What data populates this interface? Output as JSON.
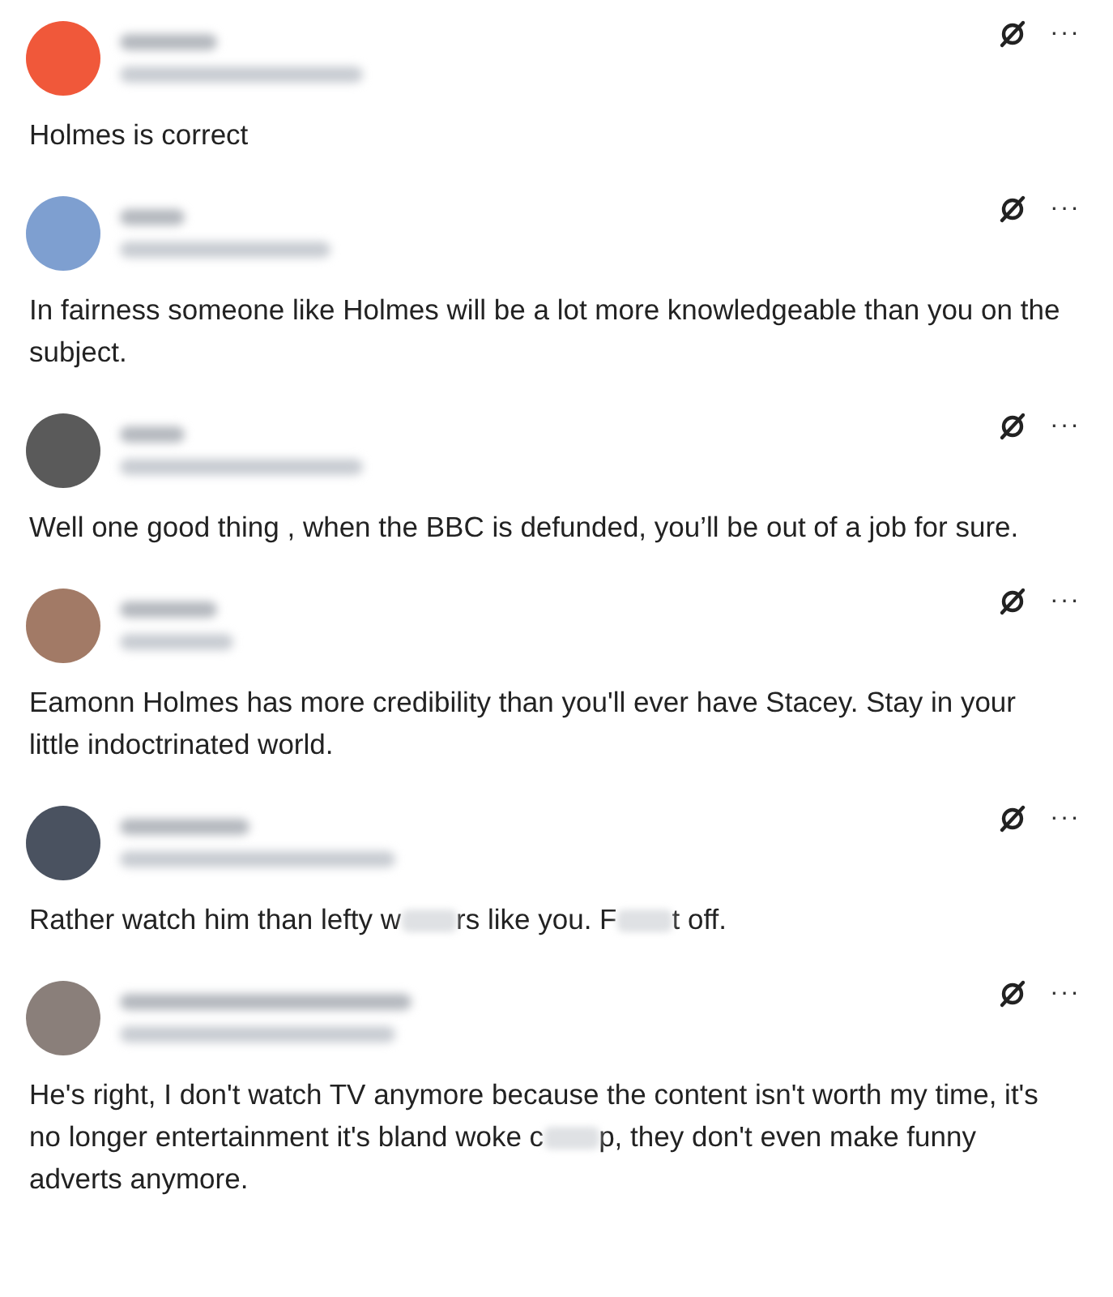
{
  "replies": [
    {
      "color": "#f0583a",
      "more": "···",
      "parts": [
        "Holmes is correct"
      ]
    },
    {
      "color": "#7e9fd0",
      "more": "···",
      "parts": [
        "In fairness someone like Holmes will be a lot more knowledgeable than you on the subject."
      ]
    },
    {
      "color": "#5a5a5a",
      "more": "···",
      "parts": [
        "Well one good thing , when the BBC is defunded, you’ll be out of a job for sure."
      ]
    },
    {
      "color": "#a27a66",
      "more": "···",
      "parts": [
        "Eamonn Holmes has more credibility than you'll ever have Stacey. Stay in your little indoctrinated world."
      ]
    },
    {
      "color": "#4a5260",
      "more": "···",
      "parts": [
        "Rather watch him than lefty w",
        "rs like you. F",
        "t off."
      ]
    },
    {
      "color": "#8a7f7a",
      "more": "···",
      "parts": [
        "He's right, I don't watch TV anymore because the content isn't worth my time, it's no longer entertainment it's bland woke c",
        "p, they don't even make funny adverts anymore."
      ]
    }
  ]
}
